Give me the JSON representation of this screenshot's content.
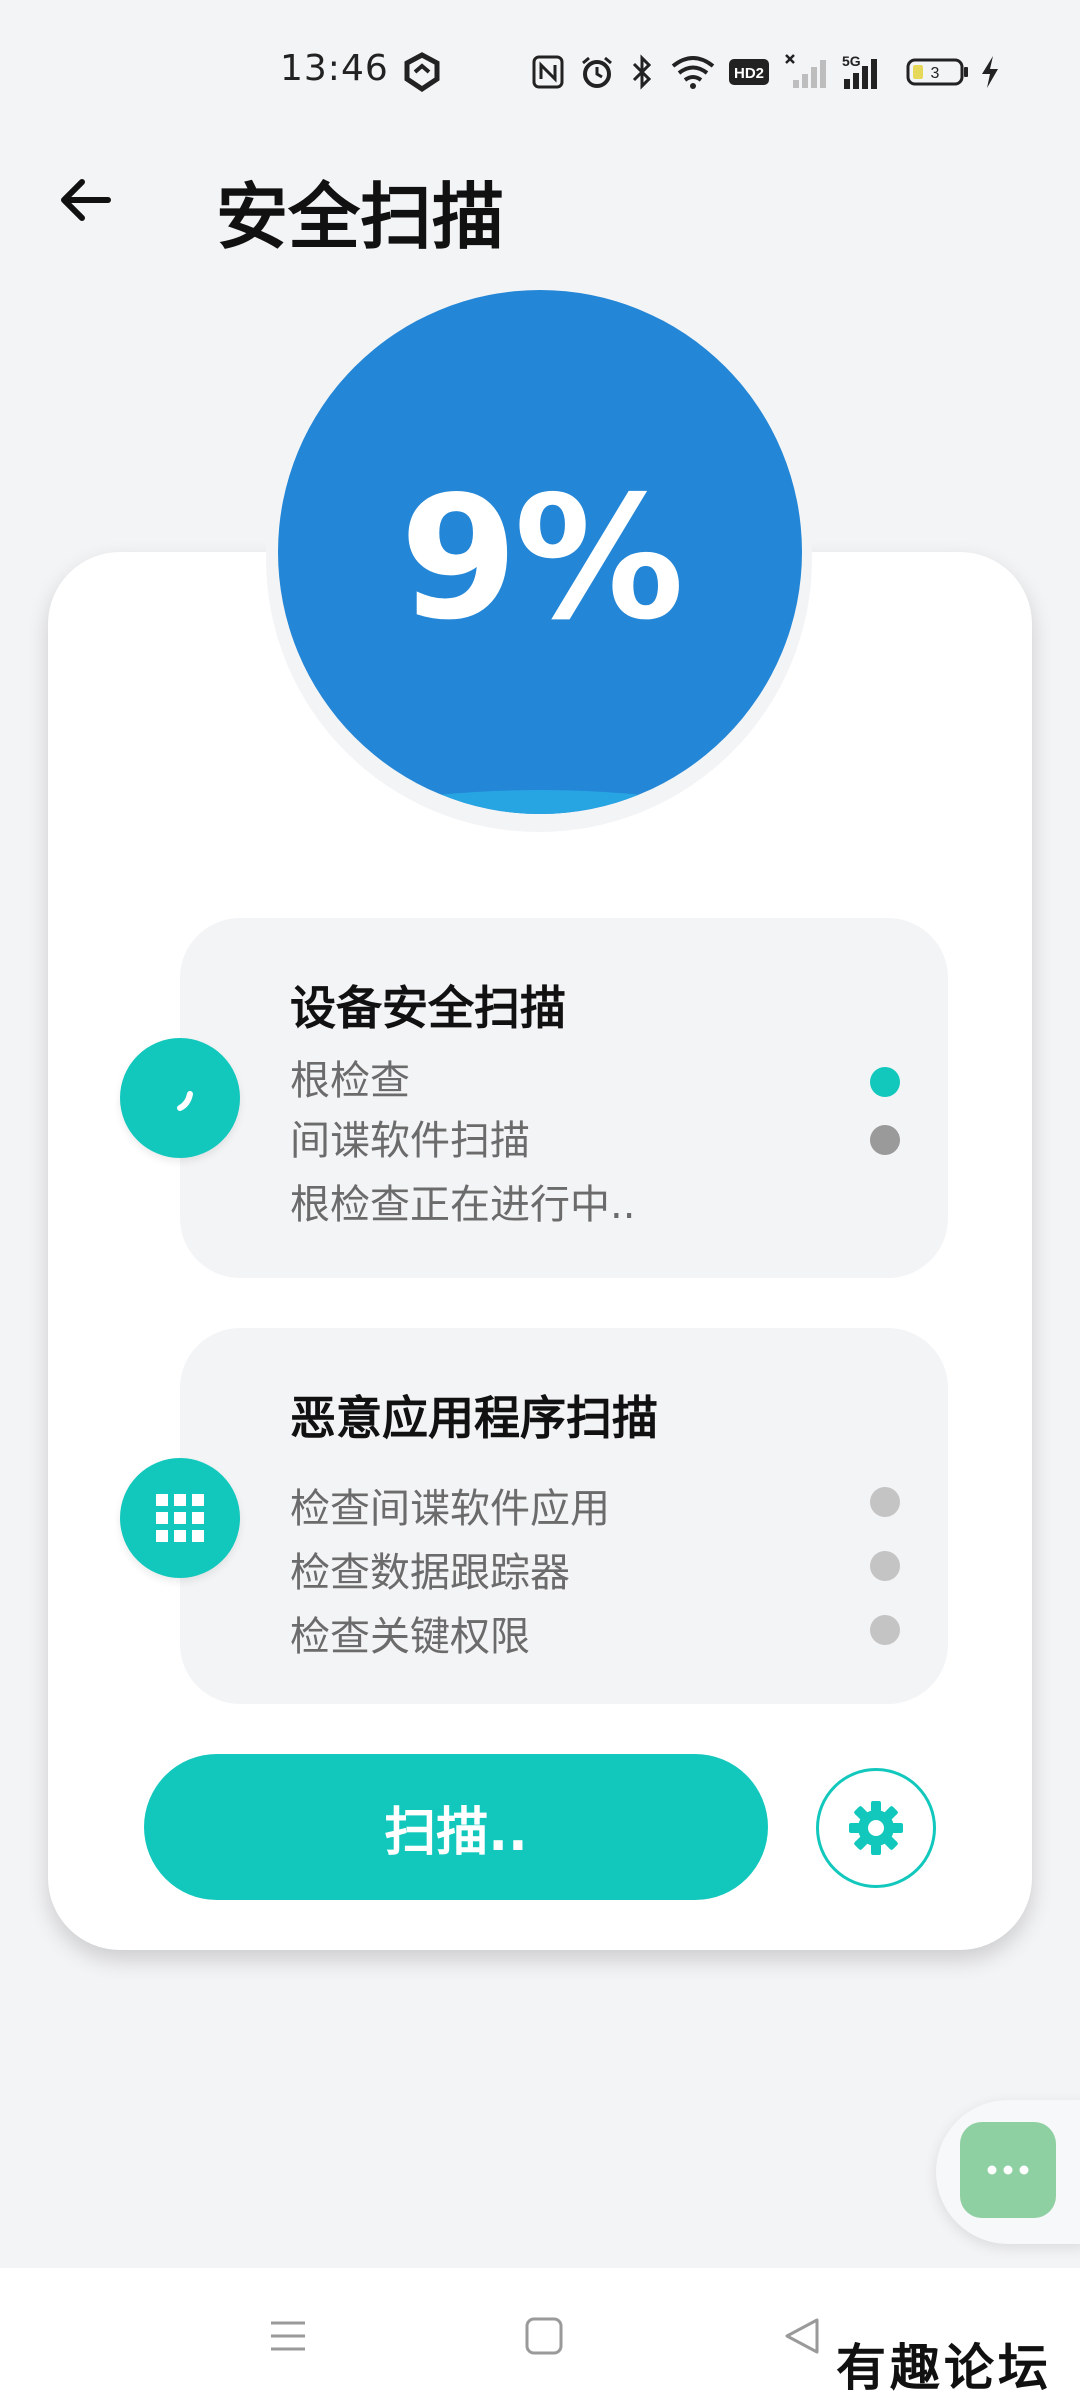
{
  "status_bar": {
    "time": "13:46",
    "icons": [
      "app-shield-icon",
      "nfc-icon",
      "alarm-icon",
      "bluetooth-icon",
      "wifi-icon",
      "hd-icon",
      "no-signal-icon",
      "5g-signal-icon",
      "battery-icon",
      "charging-icon"
    ],
    "hd_label": "HD2",
    "network_label": "5G",
    "battery_level": "3"
  },
  "header": {
    "title": "安全扫描",
    "back_icon": "arrow-left-icon"
  },
  "progress": {
    "text": "9%",
    "value_percent": 9,
    "circle_color": "#2386d6"
  },
  "sections": [
    {
      "title": "设备安全扫描",
      "icon": "spinner-icon",
      "items": [
        {
          "label": "根检查",
          "status": "active"
        },
        {
          "label": "间谍软件扫描",
          "status": "pending"
        }
      ],
      "status_text": "根检查正在进行中.."
    },
    {
      "title": "恶意应用程序扫描",
      "icon": "apps-grid-icon",
      "items": [
        {
          "label": "检查间谍软件应用",
          "status": "pending"
        },
        {
          "label": "检查数据跟踪器",
          "status": "pending"
        },
        {
          "label": "检查关键权限",
          "status": "pending"
        }
      ]
    }
  ],
  "actions": {
    "scan_label": "扫描..",
    "settings_icon": "gear-icon"
  },
  "floating": {
    "icon": "more-dots-icon"
  },
  "nav": {
    "icons": [
      "menu-icon",
      "home-square-icon",
      "back-triangle-icon"
    ]
  },
  "watermark": "有趣论坛",
  "colors": {
    "accent": "#12c8bd",
    "active_dot": "#12c8bd",
    "pending_dot": "#9a9a9a",
    "inactive_dot": "#c4c4c4",
    "background": "#f3f4f6"
  }
}
